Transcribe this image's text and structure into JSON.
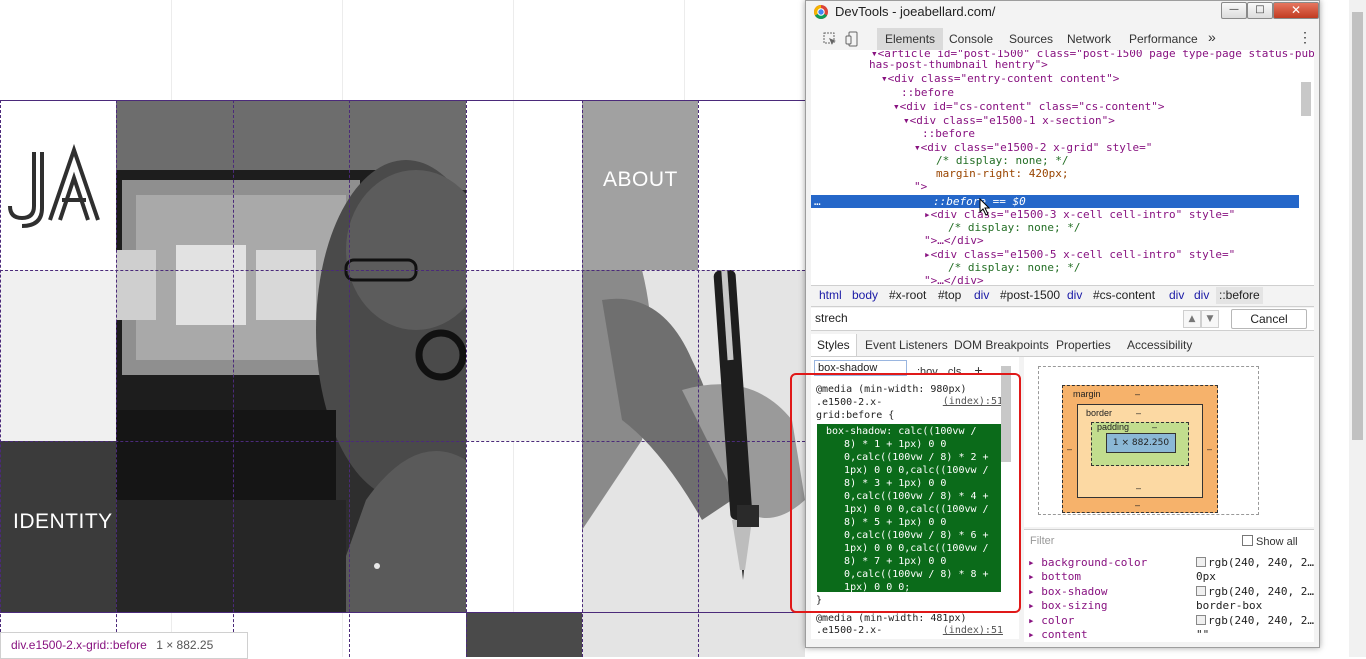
{
  "site": {
    "logo_text": "JA",
    "tile_about": "ABOUT",
    "tile_identity": "IDENTITY",
    "colors": {
      "grid_line": "#4b2a7a",
      "tile_gray": "#a1a1a1",
      "tile_dark": "#3b3b3b",
      "tile_light": "#f0f0f0"
    }
  },
  "devtools": {
    "window_title": "DevTools - joeabellard.com/",
    "main_tabs": [
      "Elements",
      "Console",
      "Sources",
      "Network",
      "Performance"
    ],
    "more_tabs_icon": "double-chevron-right-icon",
    "dom_lines": {
      "l0_a": "<article id=\"post-1500\" class=\"post-1500 page type-page status-publish",
      "l0_b": "has-post-thumbnail hentry\">",
      "l1": "<div class=\"entry-content content\">",
      "l2": "::before",
      "l3": "<div id=\"cs-content\" class=\"cs-content\">",
      "l4": "<div class=\"e1500-1 x-section\">",
      "l5": "::before",
      "l6": "<div class=\"e1500-2 x-grid\" style=\"",
      "l7": "/* display: none; */",
      "l8": "margin-right: 420px;",
      "l9": "\">",
      "l10": "::before == $0",
      "l11": "<div class=\"e1500-3 x-cell cell-intro\" style=\"",
      "l12": "/* display: none; */",
      "l13": "\">…</div>",
      "l14": "<div class=\"e1500-5 x-cell cell-intro\" style=\"",
      "l15": "/* display: none; */",
      "l16": "\">…</div>"
    },
    "breadcrumbs": [
      "html",
      "body",
      "#x-root",
      "#top",
      "div",
      "#post-1500",
      "div",
      "#cs-content",
      "div",
      "div",
      "::before"
    ],
    "search": {
      "value": "strech",
      "cancel_label": "Cancel"
    },
    "sub_tabs": [
      "Styles",
      "Event Listeners",
      "DOM Breakpoints",
      "Properties",
      "Accessibility"
    ],
    "styles": {
      "filter_value": "box-shadow",
      "hov_label": ":hov",
      "cls_label": ".cls",
      "add_icon": "+",
      "rule1_media": "@media (min-width: 980px)",
      "rule1_selector_a": ".e1500-2.x-",
      "rule1_selector_b": "grid:before {",
      "rule1_source": "(index):51",
      "decl_lines": [
        "box-shadow: calc((100vw /",
        "   8) * 1 + 1px) 0 0",
        "   0,calc((100vw / 8) * 2 +",
        "   1px) 0 0 0,calc((100vw /",
        "   8) * 3 + 1px) 0 0",
        "   0,calc((100vw / 8) * 4 +",
        "   1px) 0 0 0,calc((100vw /",
        "   8) * 5 + 1px) 0 0",
        "   0,calc((100vw / 8) * 6 +",
        "   1px) 0 0 0,calc((100vw /",
        "   8) * 7 + 1px) 0 0",
        "   0,calc((100vw / 8) * 8 +",
        "   1px) 0 0 0;"
      ],
      "rule1_close": "}",
      "rule2_media": "@media (min-width: 481px)",
      "rule2_selector_a": ".e1500-2.x-",
      "rule2_source": "(index):51"
    },
    "box_model": {
      "margin_label": "margin",
      "border_label": "border",
      "padding_label": "padding",
      "content_size": "1 × 882.250",
      "dash": "–"
    },
    "computed": {
      "filter_placeholder": "Filter",
      "show_all_label": "Show all",
      "props": [
        {
          "name": "background-color",
          "value": "rgb(240, 240, 2…"
        },
        {
          "name": "bottom",
          "value": "0px"
        },
        {
          "name": "box-shadow",
          "value": "rgb(240, 240, 2…"
        },
        {
          "name": "box-sizing",
          "value": "border-box"
        },
        {
          "name": "color",
          "value": "rgb(240, 240, 2…"
        },
        {
          "name": "content",
          "value": "\"\""
        }
      ]
    }
  },
  "status_tip": {
    "element": "div.e1500-2.x-grid::before",
    "size": "1 × 882.25"
  }
}
